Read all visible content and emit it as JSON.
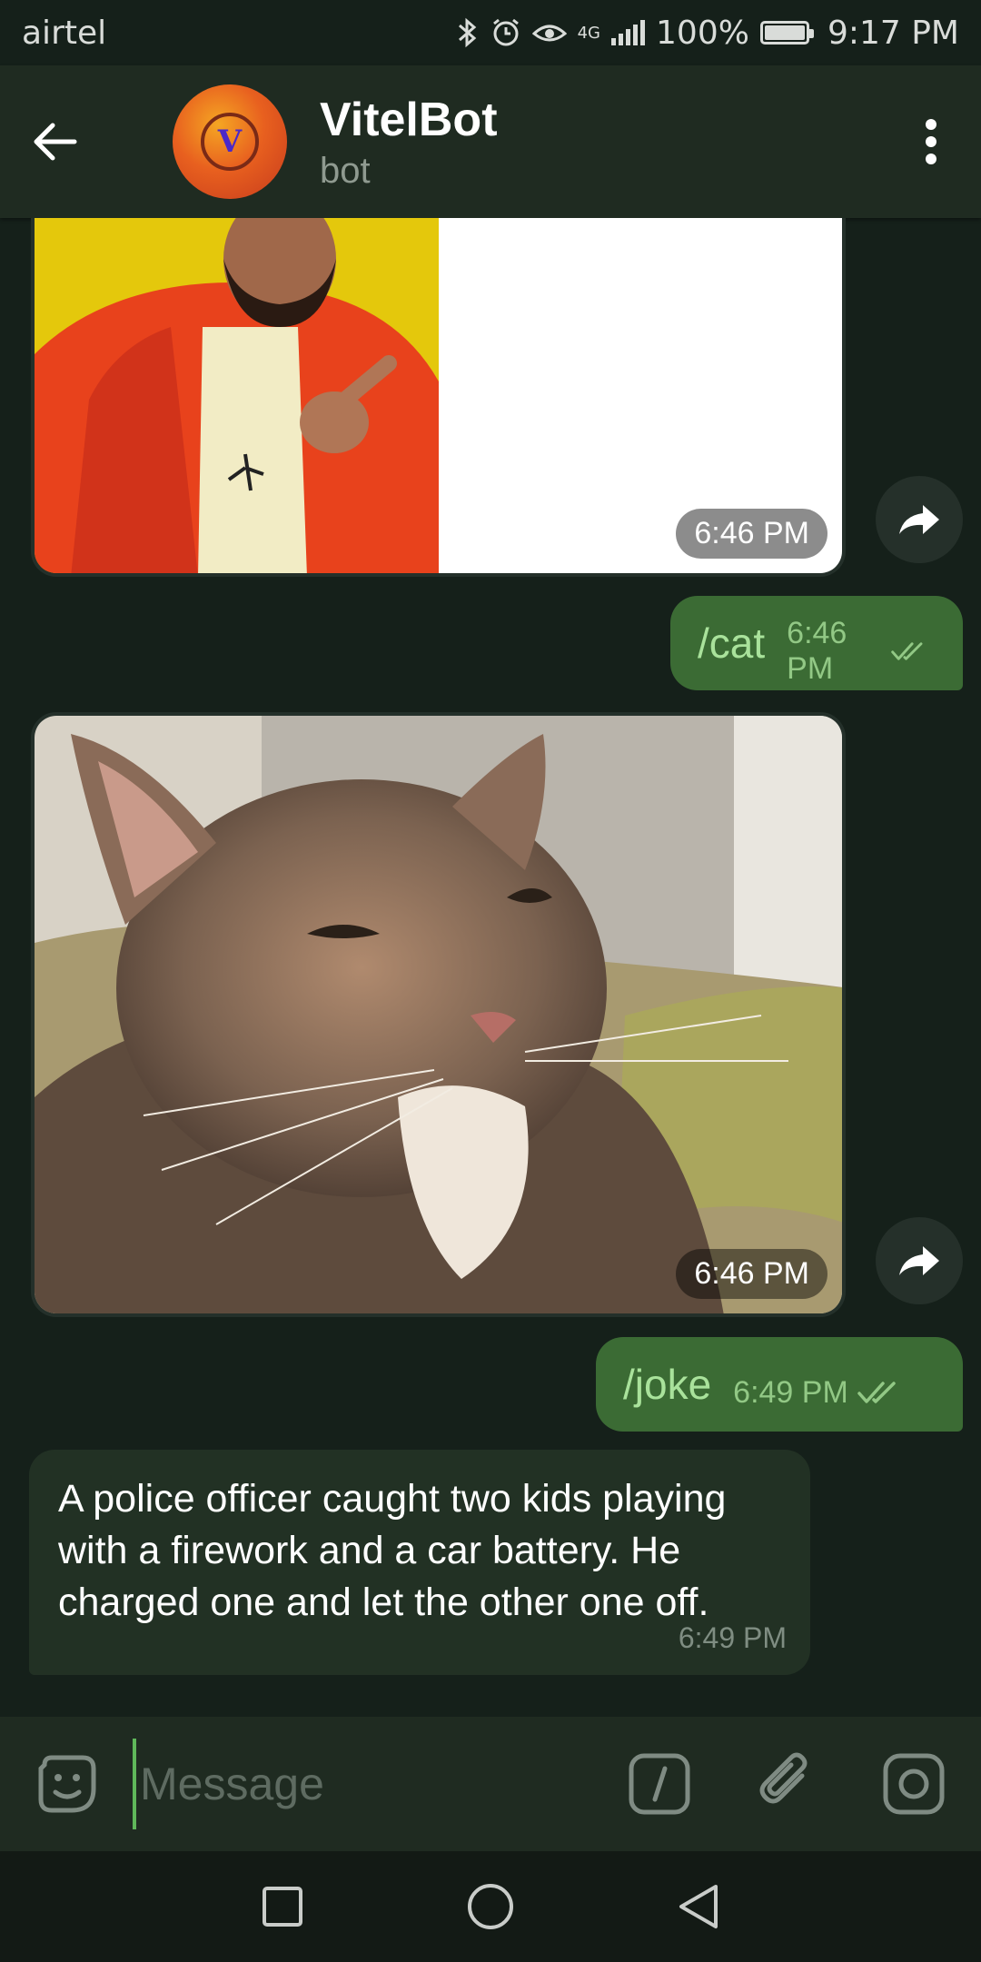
{
  "status_bar": {
    "carrier": "airtel",
    "network": "4G",
    "battery": "100%",
    "time": "9:17 PM"
  },
  "header": {
    "title": "VitelBot",
    "subtitle": "bot",
    "avatar_letter": "V"
  },
  "messages": [
    {
      "type": "photo",
      "direction": "in",
      "description": "drake-meme",
      "time": "6:46 PM"
    },
    {
      "type": "text",
      "direction": "out",
      "text": "/cat",
      "time": "6:46 PM",
      "status": "read"
    },
    {
      "type": "photo",
      "direction": "in",
      "description": "cat-photo",
      "time": "6:46 PM"
    },
    {
      "type": "text",
      "direction": "out",
      "text": "/joke",
      "time": "6:49 PM",
      "status": "read"
    },
    {
      "type": "text",
      "direction": "in",
      "text": "A police officer caught two kids playing with a firework and a car battery. He charged one and let the other one off.",
      "time": "6:49 PM"
    }
  ],
  "input": {
    "placeholder": "Message"
  },
  "colors": {
    "background": "#15201a",
    "header": "#1f2b21",
    "outgoing_bubble": "#3b6b34",
    "incoming_bubble": "#223124",
    "accent": "#5fb85a"
  }
}
